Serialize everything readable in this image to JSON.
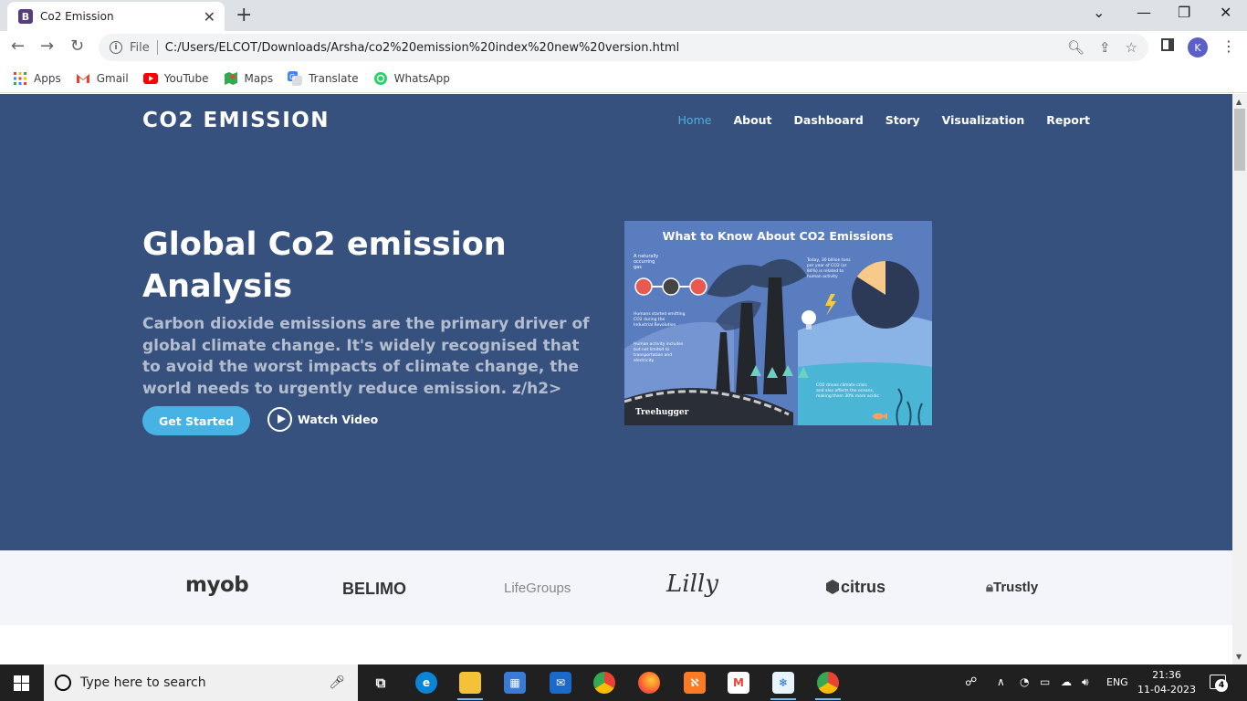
{
  "browser": {
    "tab_title": "Co2 Emission",
    "tab_favicon_letter": "B",
    "url_scheme": "File",
    "url": "C:/Users/ELCOT/Downloads/Arsha/co2%20emission%20index%20new%20version.html",
    "profile_initial": "K",
    "bookmarks": [
      {
        "label": "Apps",
        "icon": "apps-grid-icon",
        "color": "#ea4335"
      },
      {
        "label": "Gmail",
        "icon": "gmail-icon",
        "color": "#ea4335"
      },
      {
        "label": "YouTube",
        "icon": "youtube-icon",
        "color": "#ff0000"
      },
      {
        "label": "Maps",
        "icon": "maps-icon",
        "color": "#34a853"
      },
      {
        "label": "Translate",
        "icon": "translate-icon",
        "color": "#4285f4"
      },
      {
        "label": "WhatsApp",
        "icon": "whatsapp-icon",
        "color": "#25d366"
      }
    ]
  },
  "site": {
    "logo": "CO2 EMISSION",
    "nav": [
      "Home",
      "About",
      "Dashboard",
      "Story",
      "Visualization",
      "Report"
    ],
    "active_nav": "Home",
    "hero_title": "Global Co2 emission Analysis",
    "hero_subtitle": "Carbon dioxide emissions are the primary driver of global climate change. It's widely recognised that to avoid the worst impacts of climate change, the world needs to urgently reduce emission. z/h2>",
    "cta_button": "Get Started",
    "video_button": "Watch Video",
    "colors": {
      "hero_bg": "#37517e",
      "accent": "#47b2e4",
      "clients_bg": "#f3f5fa"
    }
  },
  "infographic": {
    "title": "What to Know About CO2 Emissions",
    "label_gas": "A naturally occurring gas",
    "label_today": "Today, 30 billion tons per year of CO2 (or 84%) is related to human activity",
    "label_humans": "Humans started emitting CO2 during the Industrial Revolution",
    "label_activity": "Human activity includes but not limited to transportation and electricity",
    "label_oceans": "CO2 drives climate crisis and also affects the oceans, making them 30% more acidic",
    "brand": "Treehugger",
    "pie_highlight_pct": 16
  },
  "clients": [
    "myob",
    "BELIMO",
    "LifeGroups",
    "Lilly",
    "citrus",
    "Trustly"
  ],
  "taskbar": {
    "search_placeholder": "Type here to search",
    "language": "ENG",
    "time": "21:36",
    "date": "11-04-2023",
    "notification_count": "4"
  }
}
